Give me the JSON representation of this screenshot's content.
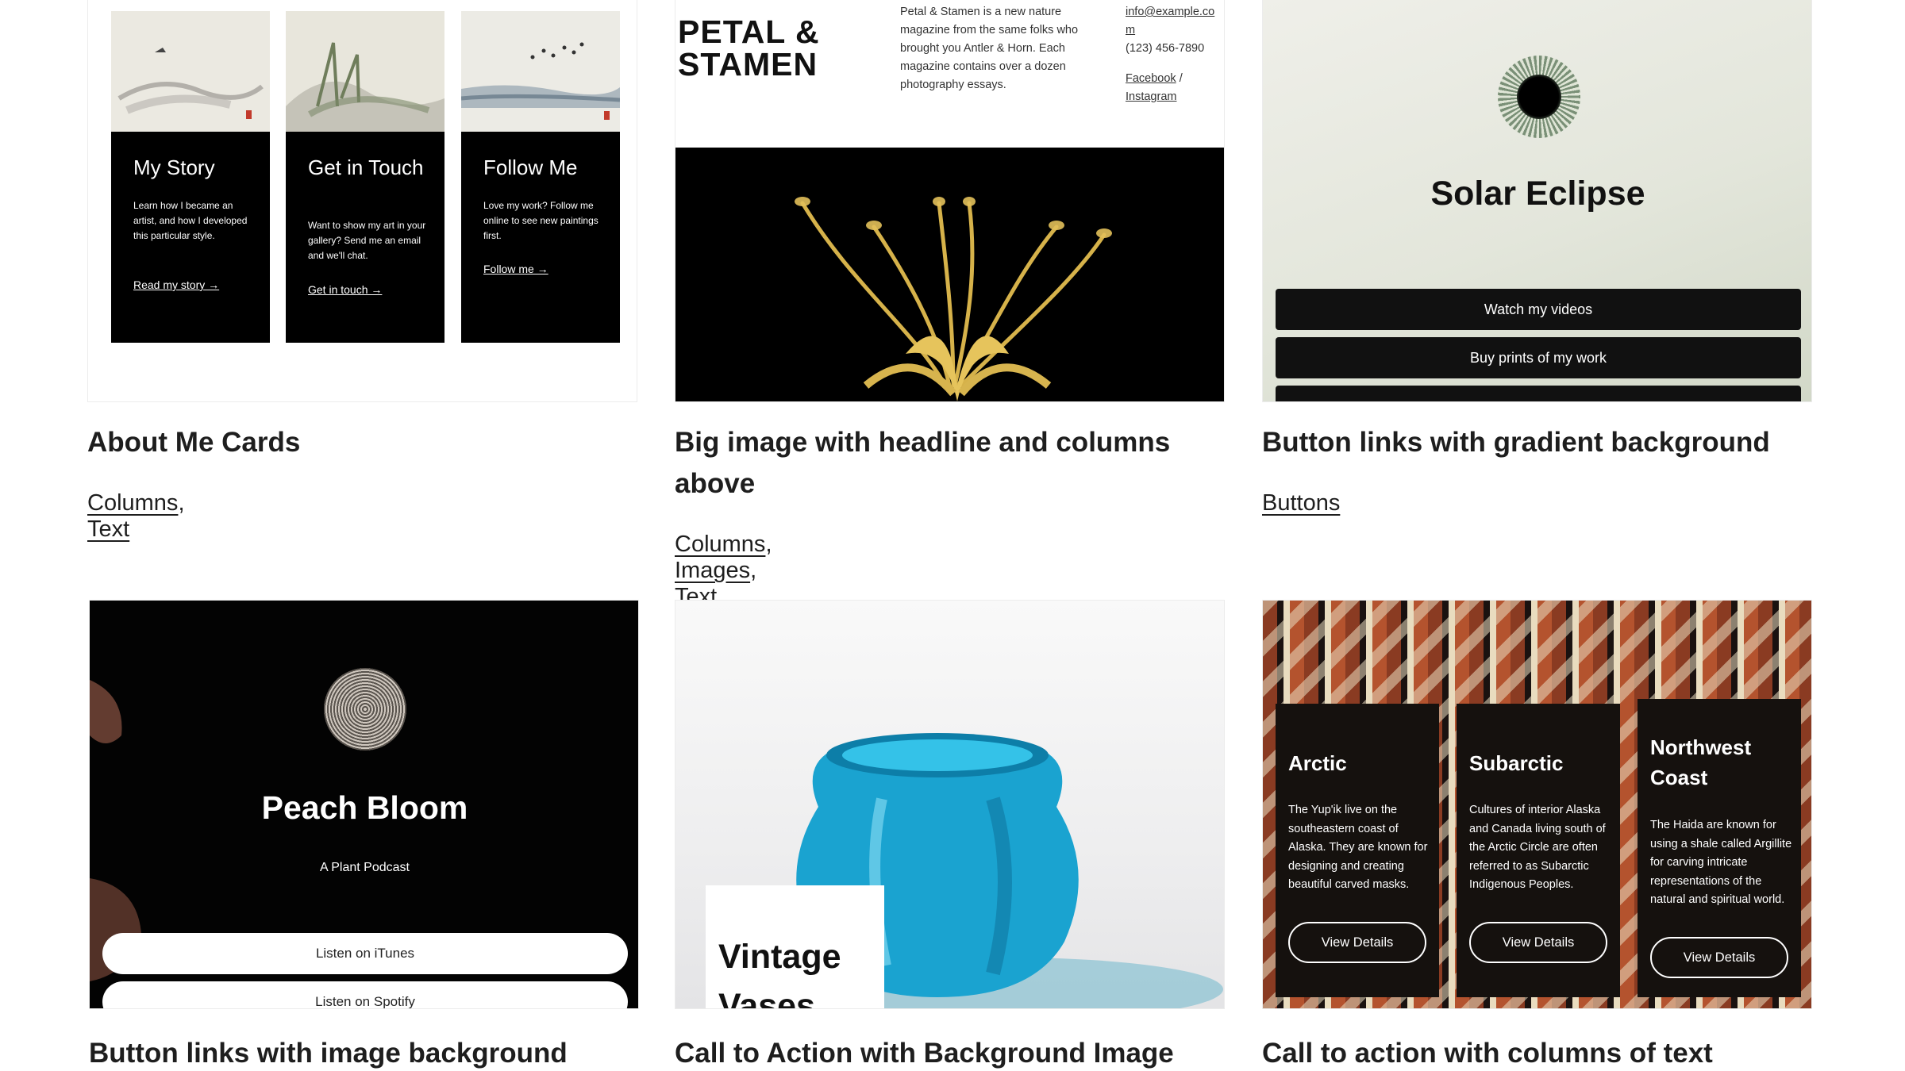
{
  "cards": [
    {
      "title": "About Me Cards",
      "tags": [
        "Columns",
        "Text"
      ],
      "preview": {
        "items": [
          {
            "title": "My Story",
            "text": "Learn how I became an artist, and how I developed this particular style.",
            "link": "Read my story →"
          },
          {
            "title": "Get in Touch",
            "text": "Want to show my art in your gallery? Send me an email and we'll chat.",
            "link": "Get in touch →"
          },
          {
            "title": "Follow Me",
            "text": "Love my work? Follow me online to see new paintings first.",
            "link": "Follow me →"
          }
        ]
      }
    },
    {
      "title": "Big image with headline and columns above",
      "tags": [
        "Columns",
        "Images",
        "Text"
      ],
      "preview": {
        "headline_line1": "PETAL &",
        "headline_line2": "STAMEN",
        "description": "Petal & Stamen is a new nature magazine from the same folks who brought you Antler & Horn. Each magazine contains over a dozen photography essays.",
        "email_line1": "info@example.co",
        "email_line2": "m",
        "phone": "(123) 456-7890",
        "social_facebook": "Facebook",
        "social_sep": " /",
        "social_instagram": "Instagram"
      }
    },
    {
      "title": "Button links with gradient background",
      "tags": [
        "Buttons"
      ],
      "preview": {
        "headline": "Solar Eclipse",
        "buttons": [
          "Watch my videos",
          "Buy prints of my work"
        ]
      }
    },
    {
      "title": "Button links with image background",
      "tags": [],
      "preview": {
        "headline": "Peach Bloom",
        "subtitle": "A Plant Podcast",
        "buttons": [
          "Listen on iTunes",
          "Listen on Spotify"
        ]
      }
    },
    {
      "title": "Call to Action with Background Image",
      "tags": [],
      "preview": {
        "headline_line1": "Vintage",
        "headline_line2": "Vases"
      }
    },
    {
      "title": "Call to action with columns of text",
      "tags": [],
      "preview": {
        "columns": [
          {
            "title": "Arctic",
            "text": "The Yup'ik live on the southeastern coast of Alaska. They are known for designing and creating beautiful carved masks.",
            "button": "View Details"
          },
          {
            "title": "Subarctic",
            "text": "Cultures of interior Alaska and Canada living south of the Arctic Circle are often referred to as Subarctic Indigenous Peoples.",
            "button": "View Details"
          },
          {
            "title": "Northwest Coast",
            "text": "The Haida are known for using a shale called Argillite for carving intricate representations of the natural and spiritual world.",
            "button": "View Details"
          }
        ]
      }
    }
  ]
}
